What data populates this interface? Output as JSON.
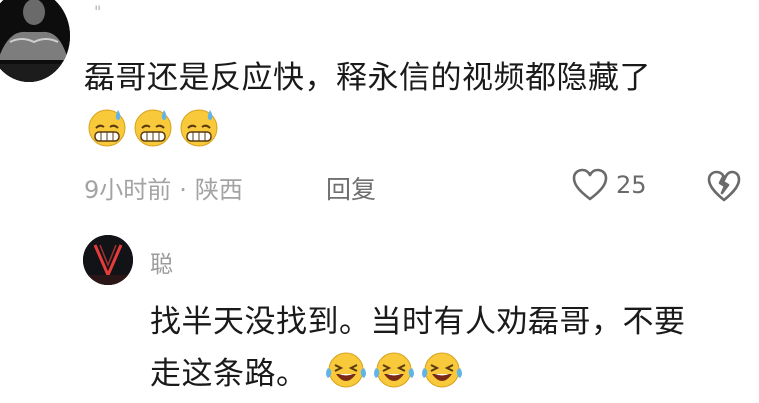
{
  "comment": {
    "quote_mark": "\"",
    "text": "磊哥还是反应快，释永信的视频都隐藏了",
    "emojis": [
      "grimacing-sweat-emoji",
      "grimacing-sweat-emoji",
      "grimacing-sweat-emoji"
    ],
    "time": "9小时前",
    "separator": "·",
    "location": "陕西",
    "reply_label": "回复",
    "likes": "25"
  },
  "reply": {
    "username": "聪",
    "text_line1": "找半天没找到。当时有人劝磊哥，不要",
    "text_line2": "走这条路。",
    "emojis": [
      "laughing-crying-emoji",
      "laughing-crying-emoji",
      "laughing-crying-emoji"
    ]
  },
  "colors": {
    "text": "#1a1a1a",
    "meta": "#a3a3a3",
    "emoji_yellow": "#f7c93b",
    "sweat_blue": "#5fb4ea",
    "avatar_red": "#e53c3c"
  }
}
